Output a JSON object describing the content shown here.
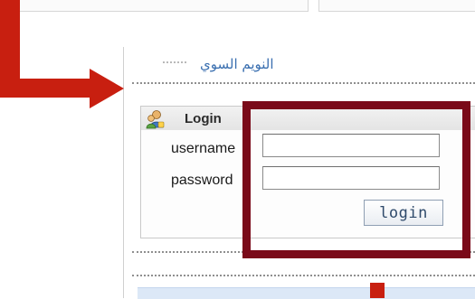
{
  "sidebar": {
    "arabic_link": "النويم السوي"
  },
  "login": {
    "title": "Login",
    "username_label": "username",
    "password_label": "password",
    "username_value": "",
    "password_value": "",
    "button_label": "login"
  },
  "colors": {
    "highlight_box": "#7a0a19",
    "arrow": "#c81f10",
    "link": "#3a6fb0"
  },
  "icons": {
    "login_icon": "users-icon"
  }
}
